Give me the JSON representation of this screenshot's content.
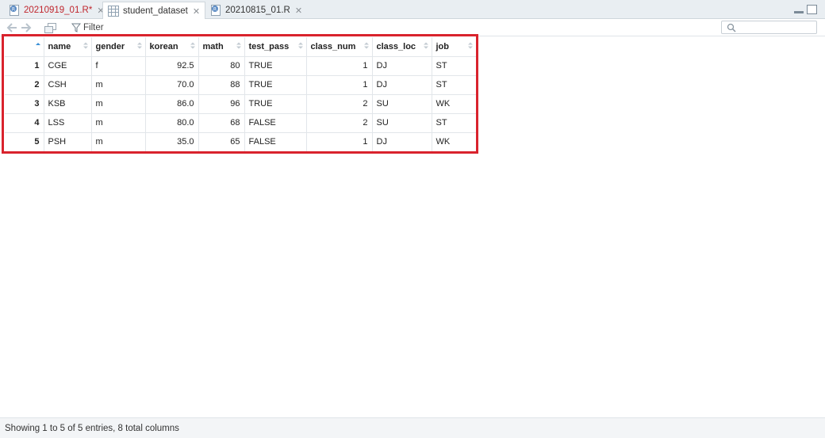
{
  "tabs": [
    {
      "label": "20210919_01.R*",
      "icon": "r-script-icon",
      "modified": true
    },
    {
      "label": "student_dataset",
      "icon": "table-icon",
      "active": true
    },
    {
      "label": "20210815_01.R",
      "icon": "r-script-icon"
    }
  ],
  "toolbar": {
    "filter_label": "Filter",
    "search_placeholder": ""
  },
  "table": {
    "columns": [
      "name",
      "gender",
      "korean",
      "math",
      "test_pass",
      "class_num",
      "class_loc",
      "job"
    ],
    "rows": [
      {
        "n": "1",
        "cells": [
          "CGE",
          "f",
          "92.5",
          "80",
          "TRUE",
          "1",
          "DJ",
          "ST"
        ]
      },
      {
        "n": "2",
        "cells": [
          "CSH",
          "m",
          "70.0",
          "88",
          "TRUE",
          "1",
          "DJ",
          "ST"
        ]
      },
      {
        "n": "3",
        "cells": [
          "KSB",
          "m",
          "86.0",
          "96",
          "TRUE",
          "2",
          "SU",
          "WK"
        ]
      },
      {
        "n": "4",
        "cells": [
          "LSS",
          "m",
          "80.0",
          "68",
          "FALSE",
          "2",
          "SU",
          "ST"
        ]
      },
      {
        "n": "5",
        "cells": [
          "PSH",
          "m",
          "35.0",
          "65",
          "FALSE",
          "1",
          "DJ",
          "WK"
        ]
      }
    ]
  },
  "status": {
    "text": "Showing 1 to 5 of 5 entries, 8 total columns"
  },
  "colors": {
    "highlight": "#d9232d",
    "modified_tab": "#c0262d"
  }
}
